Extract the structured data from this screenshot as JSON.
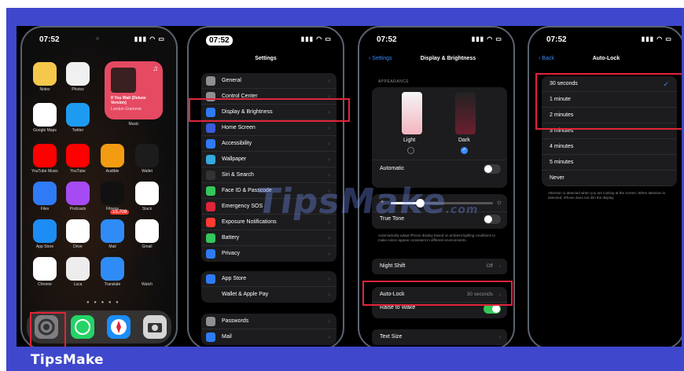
{
  "footer": {
    "brand": "TipsMake"
  },
  "watermark": {
    "text": "TipsMake",
    "suffix": ".com"
  },
  "phone1": {
    "time": "07:52",
    "apps": [
      {
        "label": "Notes",
        "color": "#f5c84c",
        "icon": "notes-icon"
      },
      {
        "label": "Photos",
        "color": "#f0f0f0",
        "icon": "photos-icon"
      },
      {
        "label": "Google Maps",
        "color": "#ffffff",
        "icon": "google-maps-icon"
      },
      {
        "label": "Twitter",
        "color": "#1d9bf0",
        "icon": "twitter-icon"
      },
      {
        "label": "YouTube Music",
        "color": "#ff0000",
        "icon": "youtube-music-icon"
      },
      {
        "label": "YouTube",
        "color": "#ff0000",
        "icon": "youtube-icon"
      },
      {
        "label": "Audible",
        "color": "#f39c12",
        "icon": "audible-icon"
      },
      {
        "label": "Wallet",
        "color": "#1c1c1c",
        "icon": "wallet-icon"
      },
      {
        "label": "Files",
        "color": "#2f7bf5",
        "icon": "files-icon"
      },
      {
        "label": "Podcasts",
        "color": "#a64bf4",
        "icon": "podcasts-icon"
      },
      {
        "label": "Fitness",
        "color": "#111111",
        "icon": "fitness-icon"
      },
      {
        "label": "Slack",
        "color": "#ffffff",
        "icon": "slack-icon"
      },
      {
        "label": "App Store",
        "color": "#1b8df5",
        "icon": "app-store-icon"
      },
      {
        "label": "Drive",
        "color": "#ffffff",
        "icon": "drive-icon"
      },
      {
        "label": "Mail",
        "color": "#2f8cf7",
        "icon": "mail-icon"
      },
      {
        "label": "Gmail",
        "color": "#ffffff",
        "icon": "gmail-icon"
      },
      {
        "label": "Chrome",
        "color": "#ffffff",
        "icon": "chrome-icon"
      },
      {
        "label": "Luca",
        "color": "#ededed",
        "icon": "luca-icon"
      },
      {
        "label": "Translate",
        "color": "#2f8cf7",
        "icon": "translate-icon"
      },
      {
        "label": "Watch",
        "color": "#111111",
        "icon": "watch-icon"
      }
    ],
    "widget": {
      "title": "If You Wait (Deluxe Version)",
      "subtitle": "London Grammar",
      "label": "Music"
    },
    "mail_badge": "15,709",
    "dock": [
      "settings-icon",
      "whatsapp-icon",
      "safari-icon",
      "camera-icon"
    ]
  },
  "phone2": {
    "time": "07:52",
    "title": "Settings",
    "group1": [
      {
        "label": "General",
        "color": "#8e8e93"
      },
      {
        "label": "Control Center",
        "color": "#8e8e93"
      },
      {
        "label": "Display & Brightness",
        "color": "#2f7bf5"
      },
      {
        "label": "Home Screen",
        "color": "#3a5bdb"
      },
      {
        "label": "Accessibility",
        "color": "#2f7bf5"
      },
      {
        "label": "Wallpaper",
        "color": "#34aadc"
      },
      {
        "label": "Siri & Search",
        "color": "#333333"
      },
      {
        "label": "Face ID & Passcode",
        "color": "#34c759"
      },
      {
        "label": "Emergency SOS",
        "color": "#e0243a"
      },
      {
        "label": "Exposure Notifications",
        "color": "#ff3b30"
      },
      {
        "label": "Battery",
        "color": "#34c759"
      },
      {
        "label": "Privacy",
        "color": "#2f7bf5"
      }
    ],
    "group2": [
      {
        "label": "App Store",
        "color": "#2f7bf5"
      },
      {
        "label": "Wallet & Apple Pay",
        "color": "#1c1c1c"
      }
    ],
    "group3": [
      {
        "label": "Passwords",
        "color": "#8e8e93"
      },
      {
        "label": "Mail",
        "color": "#2f7bf5"
      }
    ]
  },
  "phone3": {
    "time": "07:52",
    "back": "Settings",
    "title": "Display & Brightness",
    "appearance_label": "APPEARANCE",
    "light": "Light",
    "dark": "Dark",
    "automatic": "Automatic",
    "true_tone": "True Tone",
    "true_tone_note": "Automatically adapt iPhone display based on ambient lighting conditions to make colors appear consistent in different environments.",
    "night_shift": "Night Shift",
    "night_shift_value": "Off",
    "auto_lock": "Auto-Lock",
    "auto_lock_value": "30 seconds",
    "raise_to_wake": "Raise to Wake",
    "text_size": "Text Size"
  },
  "phone4": {
    "time": "07:52",
    "back": "Back",
    "title": "Auto-Lock",
    "options": [
      "30 seconds",
      "1 minute",
      "2 minutes",
      "3 minutes",
      "4 minutes",
      "5 minutes",
      "Never"
    ],
    "selected": "30 seconds",
    "note": "Attention is detected when you are looking at the screen. When attention is detected, iPhone does not dim the display."
  },
  "colors": {
    "highlight": "#e0243a",
    "brand": "#3f48cc",
    "accent": "#3a8cff"
  }
}
